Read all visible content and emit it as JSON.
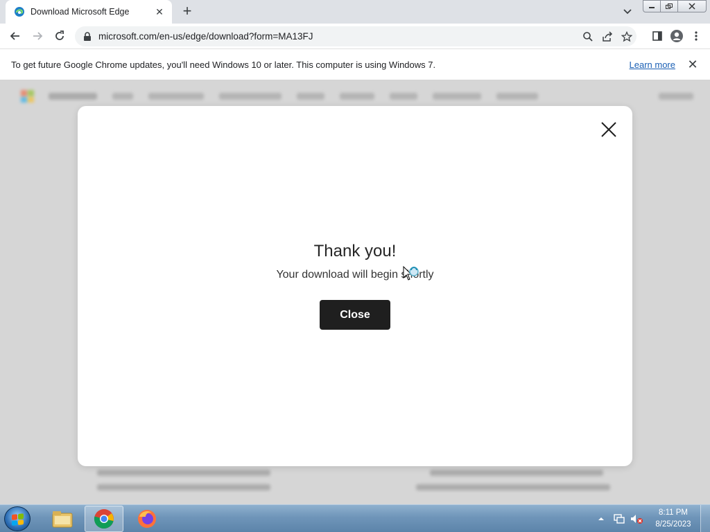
{
  "browser": {
    "tab": {
      "title": "Download Microsoft Edge",
      "favicon": "edge-icon"
    },
    "new_tab_label": "+",
    "window_controls": [
      "minimize",
      "restore",
      "close"
    ],
    "url": "microsoft.com/en-us/edge/download?form=MA13FJ"
  },
  "infobar": {
    "message": "To get future Google Chrome updates, you'll need Windows 10 or later. This computer is using Windows 7.",
    "link": "Learn more"
  },
  "modal": {
    "title": "Thank you!",
    "subtitle": "Your download will begin shortly",
    "button_label": "Close"
  },
  "taskbar": {
    "apps": [
      "file-explorer",
      "chrome",
      "firefox"
    ],
    "time": "8:11 PM",
    "date": "8/25/2023"
  },
  "colors": {
    "modal_button": "#1f1f1f",
    "link": "#1a5fb4",
    "page_overlay": "#d6d6d6"
  }
}
